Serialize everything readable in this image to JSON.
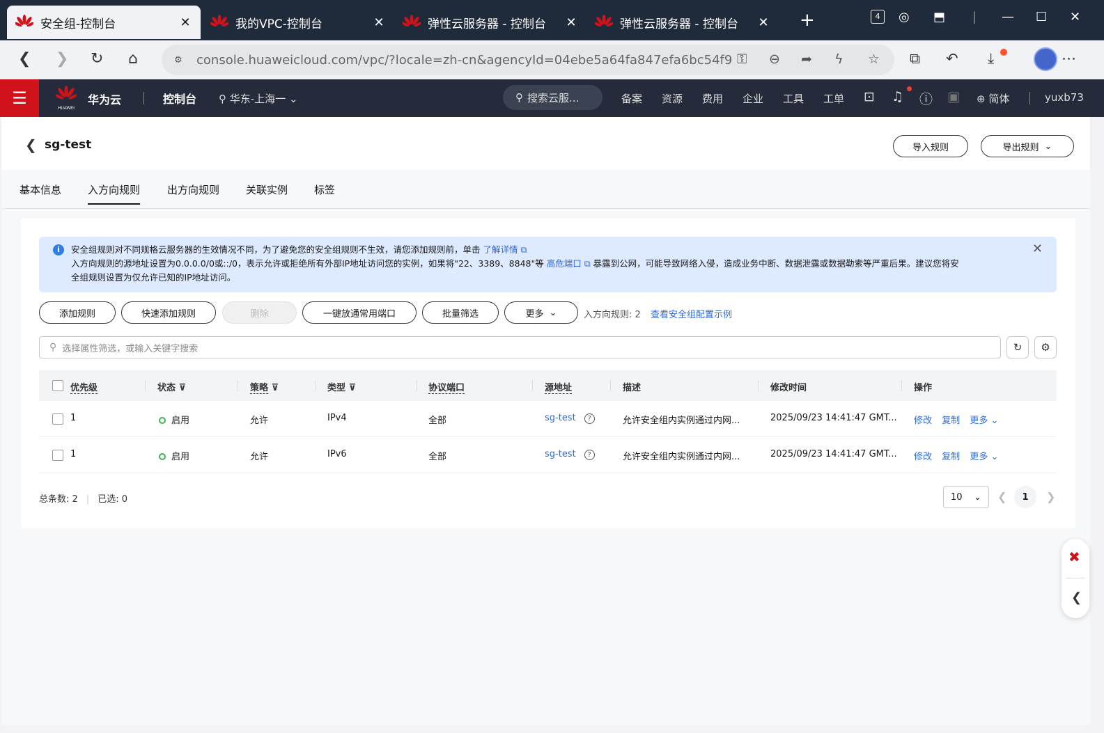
{
  "browser": {
    "tabs": [
      {
        "title": "安全组-控制台",
        "active": true
      },
      {
        "title": "我的VPC-控制台",
        "active": false
      },
      {
        "title": "弹性云服务器 - 控制台",
        "active": false
      },
      {
        "title": "弹性云服务器 - 控制台",
        "active": false
      }
    ],
    "tab_badge": "4",
    "url": "console.huaweicloud.com/vpc/?locale=zh-cn&agencyId=04ebe5a64fa847efa6bc54f919..."
  },
  "console": {
    "brand": "华为云",
    "brand_logo_text": "HUAWEI",
    "title": "控制台",
    "region": "华东-上海一",
    "search_placeholder": "搜索云服...",
    "nav": [
      "备案",
      "资源",
      "费用",
      "企业",
      "工具",
      "工单"
    ],
    "language": "简体",
    "user": "yuxb73"
  },
  "page": {
    "sg_name": "sg-test",
    "import_label": "导入规则",
    "export_label": "导出规则",
    "tabs": [
      "基本信息",
      "入方向规则",
      "出方向规则",
      "关联实例",
      "标签"
    ],
    "active_tab": "入方向规则"
  },
  "notice": {
    "line1": "安全组规则对不同规格云服务器的生效情况不同，为了避免您的安全组规则不生效，请您添加规则前，单击",
    "line1_link": "了解详情",
    "line2_pre": "入方向规则的源地址设置为0.0.0.0/0或::/0，表示允许或拒绝所有外部IP地址访问您的实例，如果将\"22、3389、8848\"等",
    "line2_link": "高危端口",
    "line2_post": "暴露到公网，可能导致网络入侵，造成业务中断、数据泄露或数据勒索等严重后果。建议您将安",
    "line3": "全组规则设置为仅允许已知的IP地址访问。"
  },
  "toolbar": {
    "add": "添加规则",
    "quick_add": "快速添加规则",
    "delete": "删除",
    "open_ports": "一键放通常用端口",
    "batch_filter": "批量筛选",
    "more": "更多",
    "rule_count_label": "入方向规则: 2",
    "view_example": "查看安全组配置示例",
    "filter_placeholder": "选择属性筛选，或输入关键字搜索"
  },
  "table": {
    "columns": [
      "优先级",
      "状态",
      "策略",
      "类型",
      "协议端口",
      "源地址",
      "描述",
      "修改时间",
      "操作"
    ],
    "rows": [
      {
        "priority": "1",
        "status": "启用",
        "policy": "允许",
        "type": "IPv4",
        "port": "全部",
        "source": "sg-test",
        "desc": "允许安全组内实例通过内网...",
        "modified": "2025/09/23 14:41:47 GMT...",
        "ops": [
          "修改",
          "复制",
          "更多"
        ]
      },
      {
        "priority": "1",
        "status": "启用",
        "policy": "允许",
        "type": "IPv6",
        "port": "全部",
        "source": "sg-test",
        "desc": "允许安全组内实例通过内网...",
        "modified": "2025/09/23 14:41:47 GMT...",
        "ops": [
          "修改",
          "复制",
          "更多"
        ]
      }
    ]
  },
  "pagination": {
    "total_label": "总条数: 2",
    "selected_label": "已选: 0",
    "page_size": "10",
    "current_page": "1"
  },
  "colors": {
    "accent": "#2f6ad8",
    "brand_red": "#d0121b",
    "status_green": "#3fb34f"
  }
}
